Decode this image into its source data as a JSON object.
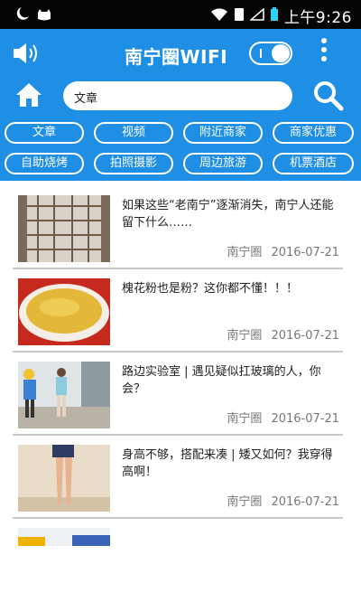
{
  "status": {
    "time": "上午9:26"
  },
  "header": {
    "title": "南宁圈WIFI",
    "search_value": "文章"
  },
  "categories": [
    "文章",
    "视频",
    "附近商家",
    "商家优惠",
    "自助烧烤",
    "拍照摄影",
    "周边旅游",
    "机票酒店"
  ],
  "articles": [
    {
      "title": "如果这些“老南宁”逐渐消失，南宁人还能留下什么……",
      "source": "南宁圈",
      "date": "2016-07-21"
    },
    {
      "title": "槐花粉也是粉？这你都不懂！！！",
      "source": "南宁圈",
      "date": "2016-07-21"
    },
    {
      "title": "路边实验室 | 遇见疑似扛玻璃的人，你会？",
      "source": "南宁圈",
      "date": "2016-07-21"
    },
    {
      "title": "身高不够，搭配来凑 | 矮又如何？我穿得高啊！",
      "source": "南宁圈",
      "date": "2016-07-21"
    }
  ],
  "colors": {
    "primary": "#1f8fe5"
  }
}
